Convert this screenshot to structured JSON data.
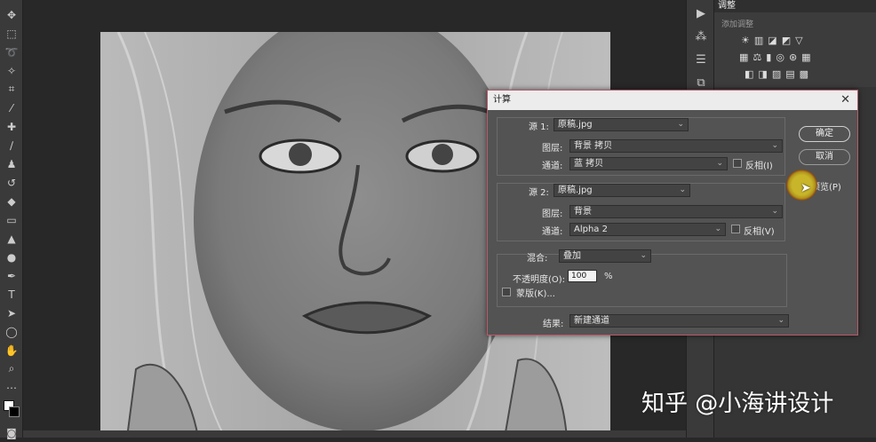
{
  "panel": {
    "tab_label": "调整",
    "subtitle": "添加调整"
  },
  "dialog": {
    "title": "计算",
    "close_glyph": "✕",
    "source1": {
      "label": "源 1:",
      "file": "原稿.jpg",
      "layer_label": "图层:",
      "layer_value": "背景 拷贝",
      "channel_label": "通道:",
      "channel_value": "蓝 拷贝",
      "invert_label": "反相(I)"
    },
    "source2": {
      "label": "源 2:",
      "file": "原稿.jpg",
      "layer_label": "图层:",
      "layer_value": "背景",
      "channel_label": "通道:",
      "channel_value": "Alpha 2",
      "invert_label": "反相(V)"
    },
    "blend": {
      "label": "混合:",
      "value": "叠加",
      "opacity_label": "不透明度(O):",
      "opacity_value": "100",
      "opacity_unit": "%",
      "mask_label": "蒙版(K)..."
    },
    "result": {
      "label": "结果:",
      "value": "新建通道"
    },
    "ok_label": "确定",
    "cancel_label": "取消",
    "preview_label": "预览(P)"
  },
  "watermark": "知乎 @小海讲设计",
  "colors": {
    "dialog_border": "#b85a6a",
    "cursor_ring": "#c9b52a"
  }
}
